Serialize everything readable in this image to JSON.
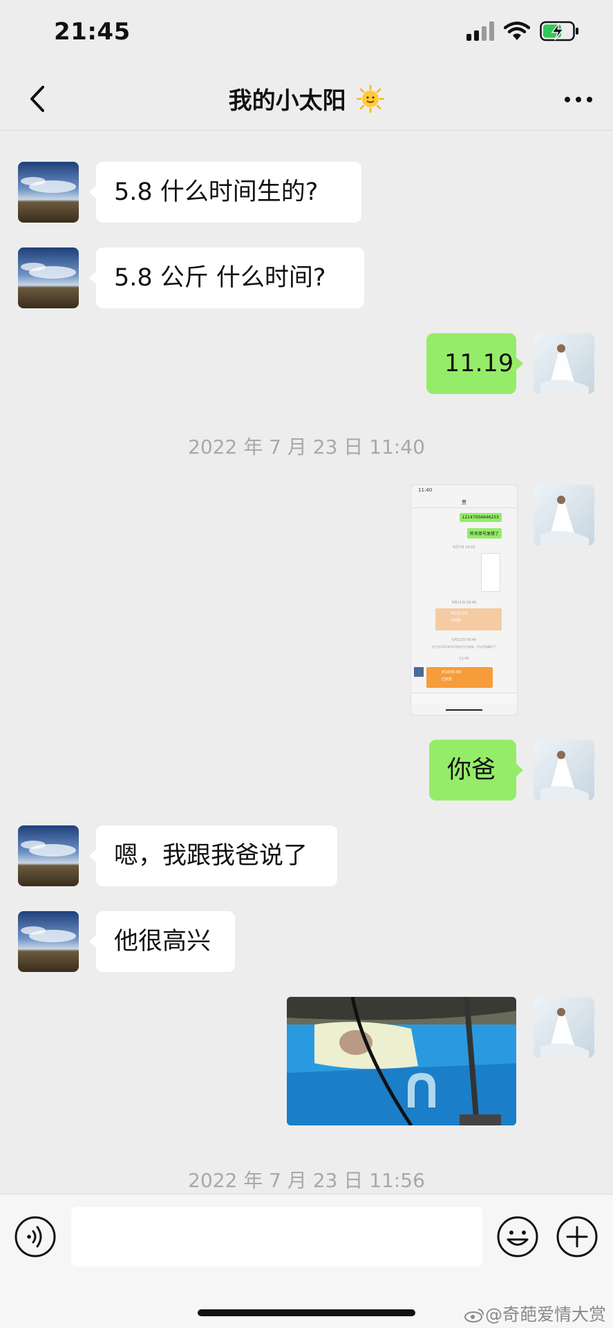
{
  "status": {
    "time": "21:45"
  },
  "header": {
    "title": "我的小太阳"
  },
  "messages": [
    {
      "side": "left",
      "text": "5.8   什么时间生的?"
    },
    {
      "side": "left",
      "text": "5.8 公斤   什么时间?"
    },
    {
      "side": "right",
      "text": "11.19"
    },
    {
      "side": "right",
      "text": "你爸"
    },
    {
      "side": "left",
      "text": "嗯，我跟我爸说了"
    },
    {
      "side": "left",
      "text": "他很高兴"
    }
  ],
  "timestamps": [
    "2022 年 7 月 23 日 11:40",
    "2022 年 7 月 23 日 11:56"
  ],
  "screenshot_thumb": {
    "time": "11:40",
    "title": "贾",
    "msg1": "12147004646253",
    "msg2": "昨天单号发错了",
    "time1": "6月7日 16:05",
    "time2": "6月21日 09:46",
    "transfer1": "¥520.00",
    "transfer1_sub": "已收款",
    "time3": "6月22日 09:46",
    "system_note": "你已在2022年6月添加对方为朋友，可以开始聊天了",
    "time4": "11:40",
    "transfer2": "¥5000.00",
    "transfer2_sub": "已收款"
  },
  "watermark": "@奇葩爱情大赏",
  "colors": {
    "bubble_right": "#95ec69",
    "bubble_left": "#ffffff",
    "background": "#ededed"
  }
}
